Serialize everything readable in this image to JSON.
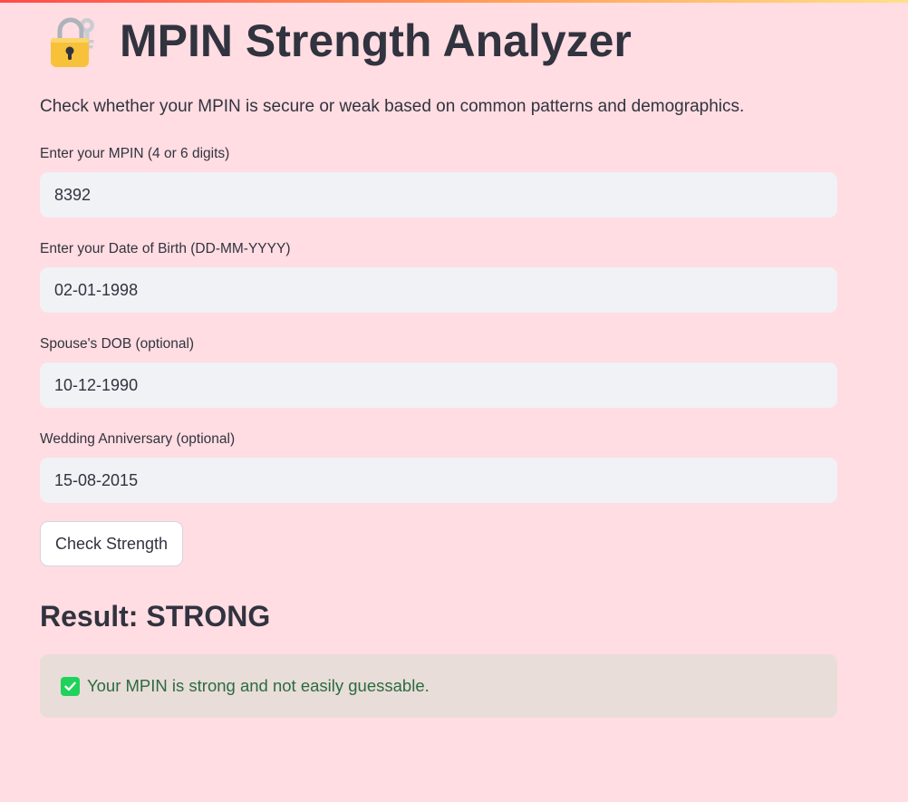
{
  "app": {
    "title": "MPIN Strength Analyzer",
    "subtitle": "Check whether your MPIN is secure or weak based on common patterns and demographics.",
    "icon": "lock-with-key-icon"
  },
  "form": {
    "mpin": {
      "label": "Enter your MPIN (4 or 6 digits)",
      "value": "8392"
    },
    "dob": {
      "label": "Enter your Date of Birth (DD-MM-YYYY)",
      "value": "02-01-1998"
    },
    "spouse_dob": {
      "label": "Spouse's DOB (optional)",
      "value": "10-12-1990"
    },
    "anniversary": {
      "label": "Wedding Anniversary (optional)",
      "value": "15-08-2015"
    },
    "submit_label": "Check Strength"
  },
  "result": {
    "heading": "Result: STRONG",
    "message": "Your MPIN is strong and not easily guessable.",
    "icon": "check-mark-icon"
  },
  "colors": {
    "background": "#ffdde2",
    "input_background": "#f0f2f6",
    "success_background": "#e8ddd9",
    "success_text": "#2c6b3f",
    "check_green": "#1fd25a",
    "lock_gold": "#f8c13a"
  }
}
